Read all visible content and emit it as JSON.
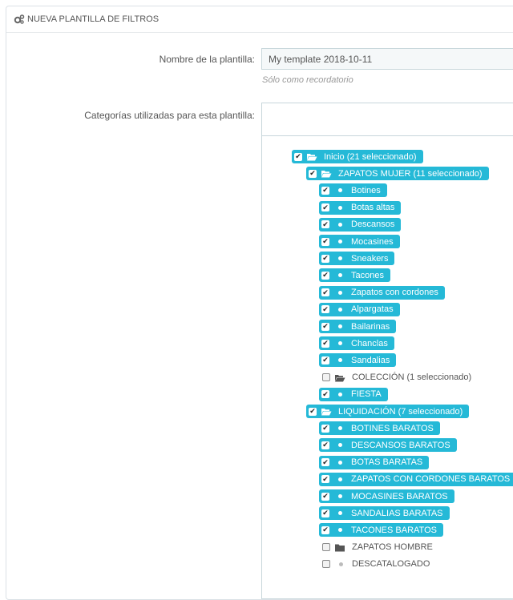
{
  "panel": {
    "title": "NUEVA PLANTILLA DE FILTROS",
    "icon": "cogs-icon"
  },
  "form": {
    "name_label": "Nombre de la plantilla:",
    "name_value": "My template 2018-10-11",
    "name_hint": "Sólo como recordatorio",
    "categories_label": "Categorías utilizadas para esta plantilla:"
  },
  "tree": [
    {
      "label": "Inicio (21 seleccionado)",
      "level": 0,
      "checked": true,
      "icon": "folder-open-icon"
    },
    {
      "label": "ZAPATOS MUJER (11 seleccionado)",
      "level": 1,
      "checked": true,
      "icon": "folder-open-icon"
    },
    {
      "label": "Botines",
      "level": 2,
      "checked": true,
      "icon": "dot-icon"
    },
    {
      "label": "Botas altas",
      "level": 2,
      "checked": true,
      "icon": "dot-icon"
    },
    {
      "label": "Descansos",
      "level": 2,
      "checked": true,
      "icon": "dot-icon"
    },
    {
      "label": "Mocasines",
      "level": 2,
      "checked": true,
      "icon": "dot-icon"
    },
    {
      "label": "Sneakers",
      "level": 2,
      "checked": true,
      "icon": "dot-icon"
    },
    {
      "label": "Tacones",
      "level": 2,
      "checked": true,
      "icon": "dot-icon"
    },
    {
      "label": "Zapatos con cordones",
      "level": 2,
      "checked": true,
      "icon": "dot-icon"
    },
    {
      "label": "Alpargatas",
      "level": 2,
      "checked": true,
      "icon": "dot-icon"
    },
    {
      "label": "Bailarinas",
      "level": 2,
      "checked": true,
      "icon": "dot-icon"
    },
    {
      "label": "Chanclas",
      "level": 2,
      "checked": true,
      "icon": "dot-icon"
    },
    {
      "label": "Sandalias",
      "level": 2,
      "checked": true,
      "icon": "dot-icon"
    },
    {
      "label": "COLECCIÓN (1 seleccionado)",
      "level": 1,
      "checked": false,
      "icon": "folder-open-icon"
    },
    {
      "label": "FIESTA",
      "level": 2,
      "checked": true,
      "icon": "dot-icon"
    },
    {
      "label": "LIQUIDACIÓN (7 seleccionado)",
      "level": 1,
      "checked": true,
      "icon": "folder-open-icon"
    },
    {
      "label": "BOTINES BARATOS",
      "level": 2,
      "checked": true,
      "icon": "dot-icon"
    },
    {
      "label": "DESCANSOS BARATOS",
      "level": 2,
      "checked": true,
      "icon": "dot-icon"
    },
    {
      "label": "BOTAS BARATAS",
      "level": 2,
      "checked": true,
      "icon": "dot-icon"
    },
    {
      "label": "ZAPATOS CON CORDONES BARATOS",
      "level": 2,
      "checked": true,
      "icon": "dot-icon"
    },
    {
      "label": "MOCASINES BARATOS",
      "level": 2,
      "checked": true,
      "icon": "dot-icon"
    },
    {
      "label": "SANDALIAS BARATAS",
      "level": 2,
      "checked": true,
      "icon": "dot-icon"
    },
    {
      "label": "TACONES BARATOS",
      "level": 2,
      "checked": true,
      "icon": "dot-icon"
    },
    {
      "label": "ZAPATOS HOMBRE",
      "level": 1,
      "checked": false,
      "icon": "folder-closed-icon"
    },
    {
      "label": "DESCATALOGADO",
      "level": 1,
      "checked": false,
      "icon": "dot-icon"
    }
  ],
  "colors": {
    "selected": "#25b9d7",
    "text": "#555555"
  }
}
